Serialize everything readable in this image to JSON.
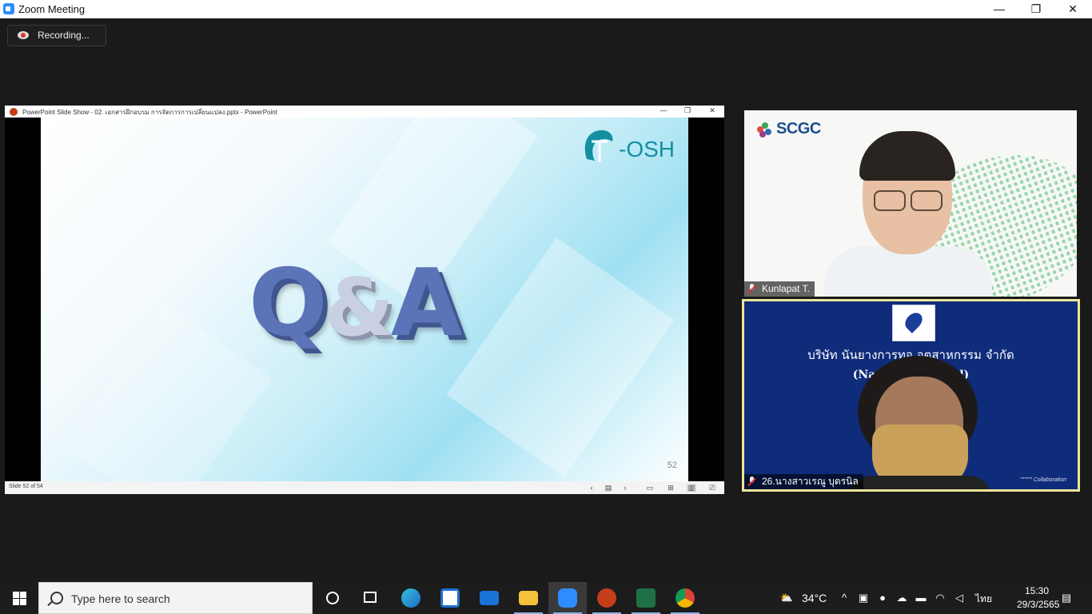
{
  "window": {
    "title": "Zoom Meeting",
    "minimize": "—",
    "restore": "❐",
    "close": "✕"
  },
  "recording": {
    "label": "Recording..."
  },
  "share": {
    "ppt_title": "PowerPoint Slide Show  -  02. เอกสารฝึกอบรม การจัดการการเปลี่ยนแปลง.pptx - PowerPoint",
    "slide": {
      "logo_text": "-OSH",
      "q": "Q",
      "amp": "&",
      "a": "A",
      "number": "52"
    },
    "status": {
      "slide_count": "Slide 52 of 54"
    }
  },
  "participants": [
    {
      "name": "Kunlapat T.",
      "logo_text": "SCGC",
      "muted": true
    },
    {
      "name": "26.นางสาวเรณู บุตรนิล",
      "muted": true,
      "background_thai": "บริษัท นันยางการทอ อุตสาหกรรม จำกัด",
      "background_eng": "(Nan Ya                         y.,Co.,Ltd)",
      "background_footer": "\"\"\"\"\"\" Collaboration",
      "active_speaker": true
    }
  ],
  "taskbar": {
    "search_placeholder": "Type here to search",
    "temperature": "34°C",
    "language": "ไทย",
    "time": "15:30",
    "date": "29/3/2565",
    "apps": [
      "cortana",
      "task-view",
      "edge",
      "store",
      "mail",
      "file-explorer",
      "zoom",
      "powerpoint",
      "excel",
      "chrome"
    ]
  },
  "colors": {
    "zoom_blue": "#2d8cff",
    "active_speaker_border": "#eae59a",
    "slide_teal": "#148fa1",
    "qa_blue": "#5b74b8",
    "nanya_blue": "#0f2c7a"
  }
}
